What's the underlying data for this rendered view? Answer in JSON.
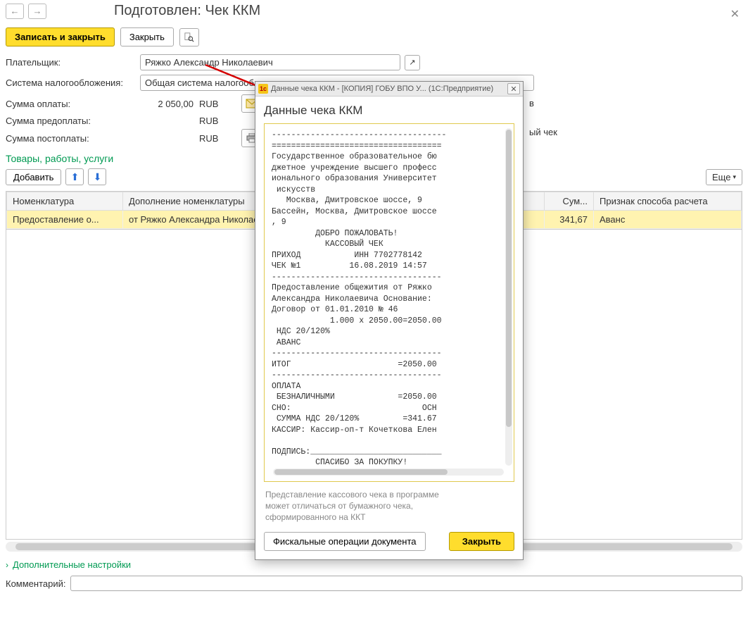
{
  "header": {
    "title": "Подготовлен: Чек ККМ"
  },
  "toolbar": {
    "write_close": "Записать и закрыть",
    "close": "Закрыть"
  },
  "form": {
    "payer_label": "Плательщик:",
    "payer_value": "Ряжко Александр Николаевич",
    "tax_label": "Система налогообложения:",
    "tax_value": "Общая система налогообложения",
    "sum_pay_label": "Сумма оплаты:",
    "sum_pay_value": "2 050,00",
    "sum_prepay_label": "Сумма предоплаты:",
    "sum_prepay_value": "",
    "sum_postpay_label": "Сумма постоплаты:",
    "sum_postpay_value": "",
    "currency": "RUB",
    "hidden_right_1": "в",
    "hidden_right_2": "ый чек"
  },
  "section": {
    "title": "Товары, работы, услуги",
    "add_btn": "Добавить",
    "more_btn": "Еще"
  },
  "table": {
    "headers": [
      "Номенклатура",
      "Дополнение номенклатуры",
      "Сум...",
      "Признак способа расчета"
    ],
    "row": {
      "nomen": "Предоставление о...",
      "dop": "от Ряжко Александра Николаевича",
      "sum": "341,67",
      "priznak": "Аванс"
    }
  },
  "footer": {
    "additional": "Дополнительные настройки",
    "comment_label": "Комментарий:"
  },
  "dialog": {
    "titlebar": "Данные чека ККМ - [КОПИЯ] ГОБУ ВПО У... (1С:Предприятие)",
    "heading": "Данные чека ККМ",
    "note": "Представление кассового чека в программе может отличаться от бумажного чека, сформированного на ККТ",
    "fiscal_btn": "Фискальные операции документа",
    "close_btn": "Закрыть",
    "receipt": "------------------------------------\n===================================\nГосударственное образовательное бю\nджетное учреждение высшего професс\nионального образования Университет\n искусств\n   Москва, Дмитровское шоссе, 9\nБассейн, Москва, Дмитровское шоссе\n, 9\n         ДОБРО ПОЖАЛОВАТЬ!\n           КАССОВЫЙ ЧЕК\nПРИХОД           ИНН 7702778142\nЧЕК №1          16.08.2019 14:57\n-----------------------------------\nПредоставление общежития от Ряжко\nАлександра Николаевича Основание:\nДоговор от 01.01.2010 № 46\n            1.000 x 2050.00=2050.00\n НДС 20/120%\n АВАНС\n-----------------------------------\nИТОГ                      =2050.00\n-----------------------------------\nОПЛАТА\n БЕЗНАЛИЧНЫМИ             =2050.00\nСНО:                           ОСН\n СУММА НДС 20/120%         =341.67\nКАССИР: Кассир-оп-т Кочеткова Елен\n\nПОДПИСЬ:___________________________\n         СПАСИБО ЗА ПОКУПКУ!"
  }
}
